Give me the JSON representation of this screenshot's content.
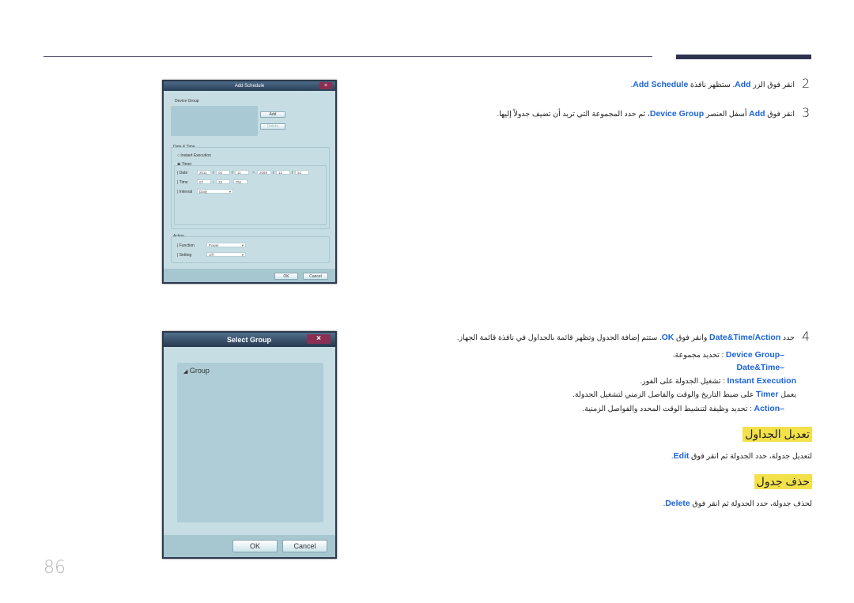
{
  "page_number": "86",
  "add_schedule_dialog": {
    "title": "Add Schedule",
    "close_label": "×",
    "device_group_label": "Device Group",
    "add_button": "Add",
    "delete_button": "Delete",
    "date_time_label": "Date & Time",
    "instant_execution_label": "Instant Execution",
    "timer_label": "Timer",
    "date_label": "Date",
    "date_start": {
      "year": "2011",
      "month": "04",
      "day": "11"
    },
    "date_separator": "~",
    "date_end": {
      "year": "2069",
      "month": "12",
      "day": "31"
    },
    "time_label": "Time",
    "time_value": {
      "hour": "07",
      "minute": "33",
      "ampm": "PM"
    },
    "interval_label": "Interval",
    "interval_value": "Daily",
    "action_label": "Action",
    "function_label": "Function",
    "function_value": "Power",
    "setting_label": "Setting",
    "setting_value": "Off",
    "ok_button": "OK",
    "cancel_button": "Cancel"
  },
  "select_group_dialog": {
    "title": "Select Group",
    "close_label": "×",
    "tree_item": "Group",
    "ok_button": "OK",
    "cancel_button": "Cancel"
  },
  "steps": [
    {
      "number": "2",
      "prefix": "انقر فوق الزر ",
      "kw1": "Add",
      "middle": ". ستظهر نافذة ",
      "kw2": "Add Schedule",
      "suffix": "."
    },
    {
      "number": "3",
      "prefix": "انقر فوق ",
      "kw1": "Add",
      "middle": " أسفل العنصر ",
      "kw2": "Device Group",
      "suffix": "، ثم حدد المجموعة التي تريد أن تضيف جدولاً إليها."
    },
    {
      "number": "4",
      "prefix": "حدد ",
      "kw1": "Date&Time/Action",
      "middle": " وانقر فوق ",
      "kw2": "OK",
      "suffix": ". ستتم إضافة الجدول وتظهر قائمة بالجداول في نافذة قائمة الجهاز."
    }
  ],
  "step4_details": [
    {
      "kw": "Device Group–",
      "text": " : تحديد مجموعة."
    },
    {
      "kw": "Date&Time–",
      "text": ""
    },
    {
      "kw": "Instant Execution",
      "text": " : تشغيل الجدولة على الفور."
    },
    {
      "pre": "يعمل ",
      "kw": "Timer",
      "text": " على ضبط التاريخ والوقت والفاصل الزمني لتشغيل الجدولة."
    },
    {
      "kw": "Action–",
      "text": " : تحديد وظيفة لتنشيط الوقت المحدد والفواصل الزمنية."
    }
  ],
  "edit_section": {
    "heading": "تعديل الجداول",
    "text": "لتعديل جدولة، حدد الجدولة ثم انقر فوق ",
    "kw": "Edit",
    "suffix": "."
  },
  "delete_section": {
    "heading": "حذف جدول",
    "text": "لحذف جدولة، حدد الجدولة ثم انقر فوق ",
    "kw": "Delete",
    "suffix": "."
  }
}
